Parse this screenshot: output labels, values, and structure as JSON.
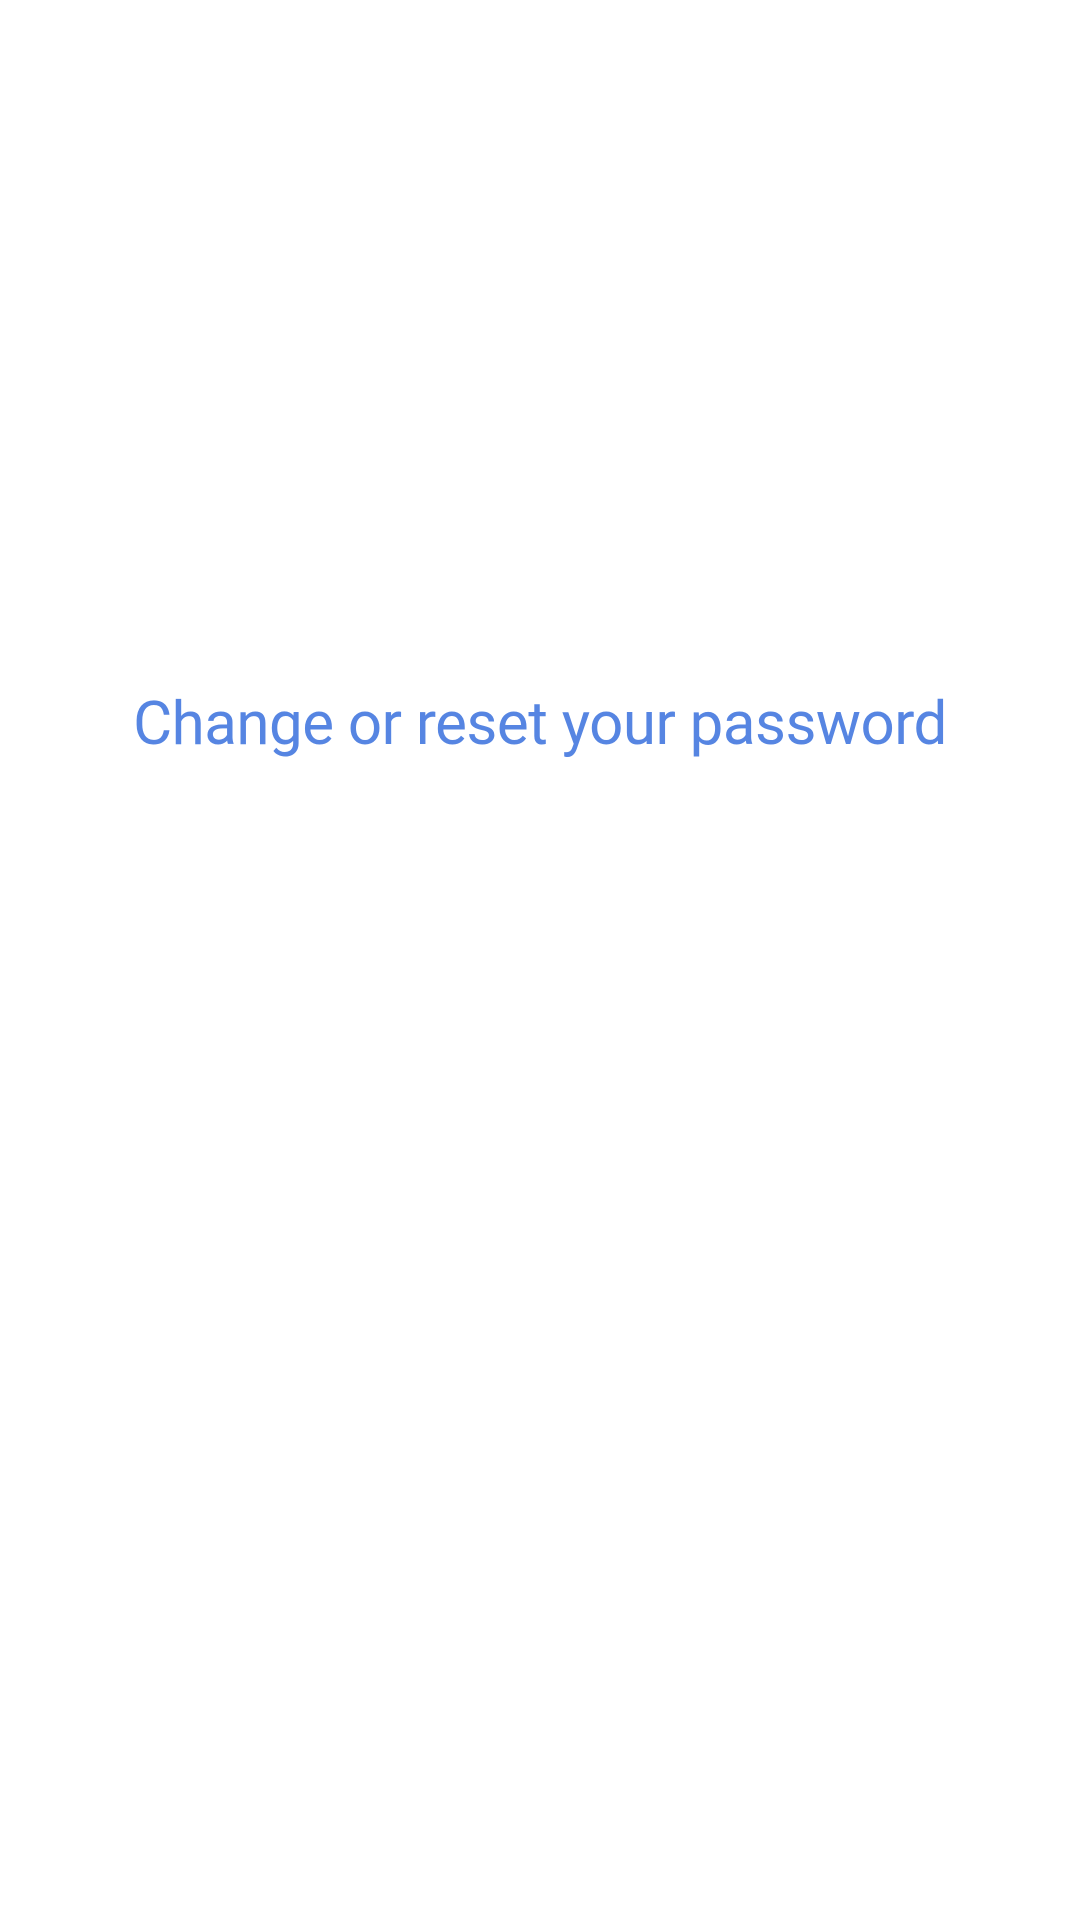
{
  "heading": {
    "text": "Change or reset your password"
  },
  "colors": {
    "headingColor": "#5685e2",
    "background": "#ffffff"
  }
}
